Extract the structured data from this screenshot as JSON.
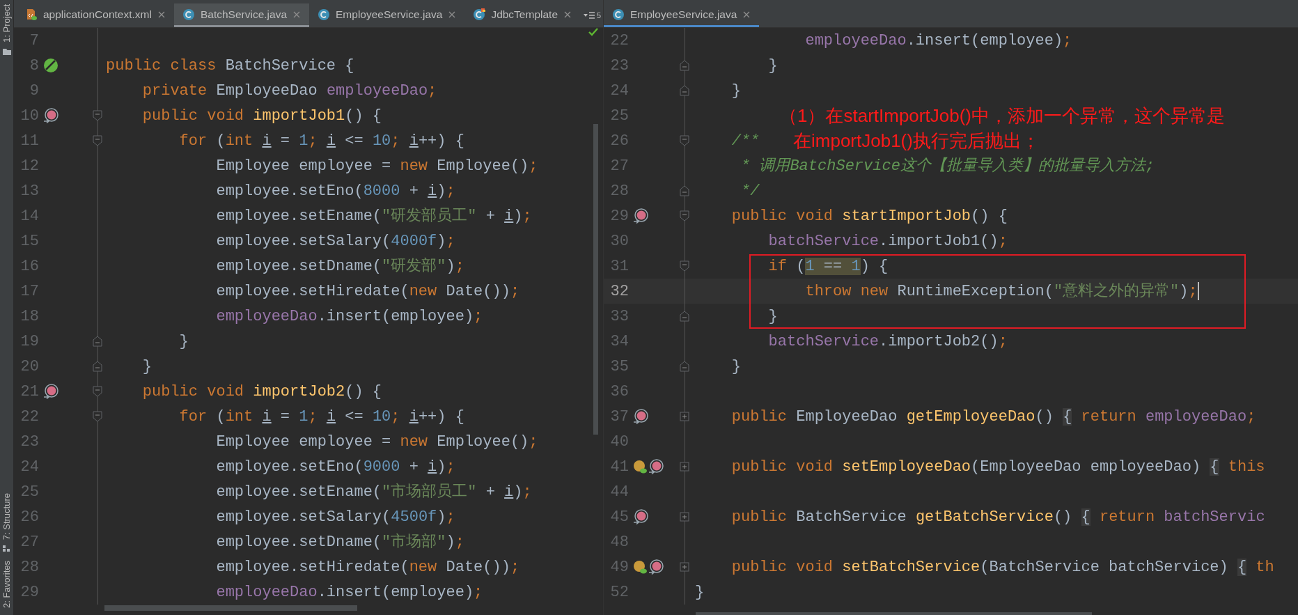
{
  "tool_strip": [
    {
      "label": "1: Project",
      "kind": "project"
    },
    {
      "label": "7: Structure",
      "kind": "structure"
    },
    {
      "label": "2: Favorites",
      "kind": "favorites"
    }
  ],
  "left_editor": {
    "tabs": [
      {
        "label": "applicationContext.xml",
        "kind": "xml",
        "selected": false
      },
      {
        "label": "BatchService.java",
        "kind": "class",
        "selected": true
      },
      {
        "label": "EmployeeService.java",
        "kind": "class",
        "selected": false
      },
      {
        "label": "JdbcTemplate",
        "kind": "library-class",
        "selected": false
      }
    ],
    "hidden_tab_count": "5",
    "lines": [
      {
        "number": "7",
        "current": false
      },
      {
        "number": "8",
        "current": false,
        "gutter": [
          {
            "kind": "bean"
          }
        ],
        "tokens": [
          {
            "text": "public class ",
            "kind": "kw"
          },
          {
            "text": "BatchService {",
            "kind": "plain"
          }
        ]
      },
      {
        "number": "9",
        "current": false,
        "tokens": [
          {
            "text": "    private ",
            "kind": "kw"
          },
          {
            "text": "EmployeeDao ",
            "kind": "plain"
          },
          {
            "text": "employeeDao",
            "kind": "field"
          },
          {
            "text": ";",
            "kind": "kw"
          }
        ]
      },
      {
        "number": "10",
        "current": false,
        "gutter": [
          {
            "kind": "method"
          }
        ],
        "fold": {
          "kind": "open"
        },
        "tokens": [
          {
            "text": "    public void ",
            "kind": "kw"
          },
          {
            "text": "importJob1",
            "kind": "method"
          },
          {
            "text": "() {",
            "kind": "plain"
          }
        ]
      },
      {
        "number": "11",
        "current": false,
        "fold": {
          "kind": "open"
        },
        "tokens": [
          {
            "text": "        for ",
            "kind": "kw"
          },
          {
            "text": "(",
            "kind": "plain"
          },
          {
            "text": "int ",
            "kind": "kw"
          },
          {
            "text": "i",
            "kind": "var"
          },
          {
            "text": " = ",
            "kind": "plain"
          },
          {
            "text": "1",
            "kind": "num"
          },
          {
            "text": "; ",
            "kind": "kw"
          },
          {
            "text": "i",
            "kind": "var"
          },
          {
            "text": " <= ",
            "kind": "plain"
          },
          {
            "text": "10",
            "kind": "num"
          },
          {
            "text": "; ",
            "kind": "kw"
          },
          {
            "text": "i",
            "kind": "var"
          },
          {
            "text": "++) {",
            "kind": "plain"
          }
        ]
      },
      {
        "number": "12",
        "current": false,
        "tokens": [
          {
            "text": "            Employee employee = ",
            "kind": "plain"
          },
          {
            "text": "new ",
            "kind": "kw"
          },
          {
            "text": "Employee()",
            "kind": "plain"
          },
          {
            "text": ";",
            "kind": "kw"
          }
        ]
      },
      {
        "number": "13",
        "current": false,
        "tokens": [
          {
            "text": "            employee.setEno(",
            "kind": "plain"
          },
          {
            "text": "8000",
            "kind": "num"
          },
          {
            "text": " + ",
            "kind": "plain"
          },
          {
            "text": "i",
            "kind": "var"
          },
          {
            "text": ")",
            "kind": "plain"
          },
          {
            "text": ";",
            "kind": "kw"
          }
        ]
      },
      {
        "number": "14",
        "current": false,
        "tokens": [
          {
            "text": "            employee.setEname(",
            "kind": "plain"
          },
          {
            "text": "\"研发部员工\"",
            "kind": "str"
          },
          {
            "text": " + ",
            "kind": "plain"
          },
          {
            "text": "i",
            "kind": "var"
          },
          {
            "text": ")",
            "kind": "plain"
          },
          {
            "text": ";",
            "kind": "kw"
          }
        ]
      },
      {
        "number": "15",
        "current": false,
        "tokens": [
          {
            "text": "            employee.setSalary(",
            "kind": "plain"
          },
          {
            "text": "4000f",
            "kind": "num"
          },
          {
            "text": ")",
            "kind": "plain"
          },
          {
            "text": ";",
            "kind": "kw"
          }
        ]
      },
      {
        "number": "16",
        "current": false,
        "tokens": [
          {
            "text": "            employee.setDname(",
            "kind": "plain"
          },
          {
            "text": "\"研发部\"",
            "kind": "str"
          },
          {
            "text": ")",
            "kind": "plain"
          },
          {
            "text": ";",
            "kind": "kw"
          }
        ]
      },
      {
        "number": "17",
        "current": false,
        "tokens": [
          {
            "text": "            employee.setHiredate(",
            "kind": "plain"
          },
          {
            "text": "new ",
            "kind": "kw"
          },
          {
            "text": "Date())",
            "kind": "plain"
          },
          {
            "text": ";",
            "kind": "kw"
          }
        ]
      },
      {
        "number": "18",
        "current": false,
        "tokens": [
          {
            "text": "            employeeDao",
            "kind": "field"
          },
          {
            "text": ".insert(employee)",
            "kind": "plain"
          },
          {
            "text": ";",
            "kind": "kw"
          }
        ]
      },
      {
        "number": "19",
        "current": false,
        "fold": {
          "kind": "close"
        },
        "tokens": [
          {
            "text": "        }",
            "kind": "plain"
          }
        ]
      },
      {
        "number": "20",
        "current": false,
        "fold": {
          "kind": "close"
        },
        "tokens": [
          {
            "text": "    }",
            "kind": "plain"
          }
        ]
      },
      {
        "number": "21",
        "current": false,
        "gutter": [
          {
            "kind": "method"
          }
        ],
        "fold": {
          "kind": "open"
        },
        "tokens": [
          {
            "text": "    public void ",
            "kind": "kw"
          },
          {
            "text": "importJob2",
            "kind": "method"
          },
          {
            "text": "() {",
            "kind": "plain"
          }
        ]
      },
      {
        "number": "22",
        "current": false,
        "fold": {
          "kind": "open"
        },
        "tokens": [
          {
            "text": "        for ",
            "kind": "kw"
          },
          {
            "text": "(",
            "kind": "plain"
          },
          {
            "text": "int ",
            "kind": "kw"
          },
          {
            "text": "i",
            "kind": "var"
          },
          {
            "text": " = ",
            "kind": "plain"
          },
          {
            "text": "1",
            "kind": "num"
          },
          {
            "text": "; ",
            "kind": "kw"
          },
          {
            "text": "i",
            "kind": "var"
          },
          {
            "text": " <= ",
            "kind": "plain"
          },
          {
            "text": "10",
            "kind": "num"
          },
          {
            "text": "; ",
            "kind": "kw"
          },
          {
            "text": "i",
            "kind": "var"
          },
          {
            "text": "++) {",
            "kind": "plain"
          }
        ]
      },
      {
        "number": "23",
        "current": false,
        "tokens": [
          {
            "text": "            Employee employee = ",
            "kind": "plain"
          },
          {
            "text": "new ",
            "kind": "kw"
          },
          {
            "text": "Employee()",
            "kind": "plain"
          },
          {
            "text": ";",
            "kind": "kw"
          }
        ]
      },
      {
        "number": "24",
        "current": false,
        "tokens": [
          {
            "text": "            employee.setEno(",
            "kind": "plain"
          },
          {
            "text": "9000",
            "kind": "num"
          },
          {
            "text": " + ",
            "kind": "plain"
          },
          {
            "text": "i",
            "kind": "var"
          },
          {
            "text": ")",
            "kind": "plain"
          },
          {
            "text": ";",
            "kind": "kw"
          }
        ]
      },
      {
        "number": "25",
        "current": false,
        "tokens": [
          {
            "text": "            employee.setEname(",
            "kind": "plain"
          },
          {
            "text": "\"市场部员工\"",
            "kind": "str"
          },
          {
            "text": " + ",
            "kind": "plain"
          },
          {
            "text": "i",
            "kind": "var"
          },
          {
            "text": ")",
            "kind": "plain"
          },
          {
            "text": ";",
            "kind": "kw"
          }
        ]
      },
      {
        "number": "26",
        "current": false,
        "tokens": [
          {
            "text": "            employee.setSalary(",
            "kind": "plain"
          },
          {
            "text": "4500f",
            "kind": "num"
          },
          {
            "text": ")",
            "kind": "plain"
          },
          {
            "text": ";",
            "kind": "kw"
          }
        ]
      },
      {
        "number": "27",
        "current": false,
        "tokens": [
          {
            "text": "            employee.setDname(",
            "kind": "plain"
          },
          {
            "text": "\"市场部\"",
            "kind": "str"
          },
          {
            "text": ")",
            "kind": "plain"
          },
          {
            "text": ";",
            "kind": "kw"
          }
        ]
      },
      {
        "number": "28",
        "current": false,
        "tokens": [
          {
            "text": "            employee.setHiredate(",
            "kind": "plain"
          },
          {
            "text": "new ",
            "kind": "kw"
          },
          {
            "text": "Date())",
            "kind": "plain"
          },
          {
            "text": ";",
            "kind": "kw"
          }
        ]
      },
      {
        "number": "29",
        "current": false,
        "tokens": [
          {
            "text": "            employeeDao",
            "kind": "field"
          },
          {
            "text": ".insert(employee)",
            "kind": "plain"
          },
          {
            "text": ";",
            "kind": "kw"
          }
        ]
      }
    ]
  },
  "right_editor": {
    "tabs": [
      {
        "label": "EmployeeService.java",
        "kind": "class",
        "selected": true
      }
    ],
    "lines": [
      {
        "number": "22",
        "current": false,
        "tokens": [
          {
            "text": "            employeeDao",
            "kind": "field"
          },
          {
            "text": ".insert(employee)",
            "kind": "plain"
          },
          {
            "text": ";",
            "kind": "kw"
          }
        ]
      },
      {
        "number": "23",
        "current": false,
        "fold": {
          "kind": "close"
        },
        "tokens": [
          {
            "text": "        }",
            "kind": "plain"
          }
        ]
      },
      {
        "number": "24",
        "current": false,
        "fold": {
          "kind": "close"
        },
        "tokens": [
          {
            "text": "    }",
            "kind": "plain"
          }
        ]
      },
      {
        "number": "25",
        "current": false
      },
      {
        "number": "26",
        "current": false,
        "fold": {
          "kind": "open"
        },
        "tokens": [
          {
            "text": "    /**",
            "kind": "doc"
          }
        ]
      },
      {
        "number": "27",
        "current": false,
        "tokens": [
          {
            "text": "     * 调用BatchService这个【批量导入类】的批量导入方法;",
            "kind": "doc"
          }
        ]
      },
      {
        "number": "28",
        "current": false,
        "fold": {
          "kind": "close"
        },
        "tokens": [
          {
            "text": "     */",
            "kind": "doc"
          }
        ]
      },
      {
        "number": "29",
        "current": false,
        "gutter": [
          {
            "kind": "method"
          }
        ],
        "fold": {
          "kind": "open"
        },
        "tokens": [
          {
            "text": "    public void ",
            "kind": "kw"
          },
          {
            "text": "startImportJob",
            "kind": "method"
          },
          {
            "text": "() {",
            "kind": "plain"
          }
        ]
      },
      {
        "number": "30",
        "current": false,
        "tokens": [
          {
            "text": "        batchService",
            "kind": "field"
          },
          {
            "text": ".importJob1()",
            "kind": "plain"
          },
          {
            "text": ";",
            "kind": "kw"
          }
        ]
      },
      {
        "number": "31",
        "current": false,
        "fold": {
          "kind": "open"
        },
        "tokens": [
          {
            "text": "        if ",
            "kind": "kw"
          },
          {
            "text": "(",
            "kind": "plain"
          },
          {
            "text": "1",
            "kind": "num-hl"
          },
          {
            "text": " == ",
            "kind": "plain-hl"
          },
          {
            "text": "1",
            "kind": "num-hl"
          },
          {
            "text": ") {",
            "kind": "plain"
          }
        ]
      },
      {
        "number": "32",
        "current": true,
        "tokens": [
          {
            "text": "            throw new ",
            "kind": "kw"
          },
          {
            "text": "RuntimeException(",
            "kind": "plain"
          },
          {
            "text": "\"意料之外的异常\"",
            "kind": "str"
          },
          {
            "text": ")",
            "kind": "plain"
          },
          {
            "text": ";",
            "kind": "kw"
          }
        ]
      },
      {
        "number": "33",
        "current": false,
        "fold": {
          "kind": "close"
        },
        "tokens": [
          {
            "text": "        }",
            "kind": "plain"
          }
        ]
      },
      {
        "number": "34",
        "current": false,
        "tokens": [
          {
            "text": "        batchService",
            "kind": "field"
          },
          {
            "text": ".importJob2()",
            "kind": "plain"
          },
          {
            "text": ";",
            "kind": "kw"
          }
        ]
      },
      {
        "number": "35",
        "current": false,
        "fold": {
          "kind": "close"
        },
        "tokens": [
          {
            "text": "    }",
            "kind": "plain"
          }
        ]
      },
      {
        "number": "36",
        "current": false
      },
      {
        "number": "37",
        "current": false,
        "gutter": [
          {
            "kind": "method"
          }
        ],
        "fold": {
          "kind": "folded"
        },
        "tokens": [
          {
            "text": "    public ",
            "kind": "kw"
          },
          {
            "text": "EmployeeDao ",
            "kind": "plain"
          },
          {
            "text": "getEmployeeDao",
            "kind": "method"
          },
          {
            "text": "() ",
            "kind": "plain"
          },
          {
            "text": "{",
            "kind": "fold"
          },
          {
            "text": " return ",
            "kind": "kw"
          },
          {
            "text": "employeeDao",
            "kind": "field"
          },
          {
            "text": ";",
            "kind": "kw"
          }
        ]
      },
      {
        "number": "40",
        "current": false
      },
      {
        "number": "41",
        "current": false,
        "gutter": [
          {
            "kind": "property"
          },
          {
            "kind": "method"
          }
        ],
        "fold": {
          "kind": "folded"
        },
        "tokens": [
          {
            "text": "    public void ",
            "kind": "kw"
          },
          {
            "text": "setEmployeeDao",
            "kind": "method"
          },
          {
            "text": "(EmployeeDao employeeDao) ",
            "kind": "plain"
          },
          {
            "text": "{",
            "kind": "fold"
          },
          {
            "text": " this",
            "kind": "kw"
          }
        ]
      },
      {
        "number": "44",
        "current": false
      },
      {
        "number": "45",
        "current": false,
        "gutter": [
          {
            "kind": "method"
          }
        ],
        "fold": {
          "kind": "folded"
        },
        "tokens": [
          {
            "text": "    public ",
            "kind": "kw"
          },
          {
            "text": "BatchService ",
            "kind": "plain"
          },
          {
            "text": "getBatchService",
            "kind": "method"
          },
          {
            "text": "() ",
            "kind": "plain"
          },
          {
            "text": "{",
            "kind": "fold"
          },
          {
            "text": " return ",
            "kind": "kw"
          },
          {
            "text": "batchServic",
            "kind": "field"
          }
        ]
      },
      {
        "number": "48",
        "current": false
      },
      {
        "number": "49",
        "current": false,
        "gutter": [
          {
            "kind": "property"
          },
          {
            "kind": "method"
          }
        ],
        "fold": {
          "kind": "folded"
        },
        "tokens": [
          {
            "text": "    public void ",
            "kind": "kw"
          },
          {
            "text": "setBatchService",
            "kind": "method"
          },
          {
            "text": "(BatchService batchService) ",
            "kind": "plain"
          },
          {
            "text": "{",
            "kind": "fold"
          },
          {
            "text": " th",
            "kind": "kw"
          }
        ]
      },
      {
        "number": "52",
        "current": false,
        "tokens": [
          {
            "text": "}",
            "kind": "plain"
          }
        ]
      }
    ],
    "annotations": [
      {
        "text": "（1）在startImportJob()中，添加一个异常，这个异常是"
      },
      {
        "text": "在importJob1()执行完后抛出；"
      }
    ]
  }
}
